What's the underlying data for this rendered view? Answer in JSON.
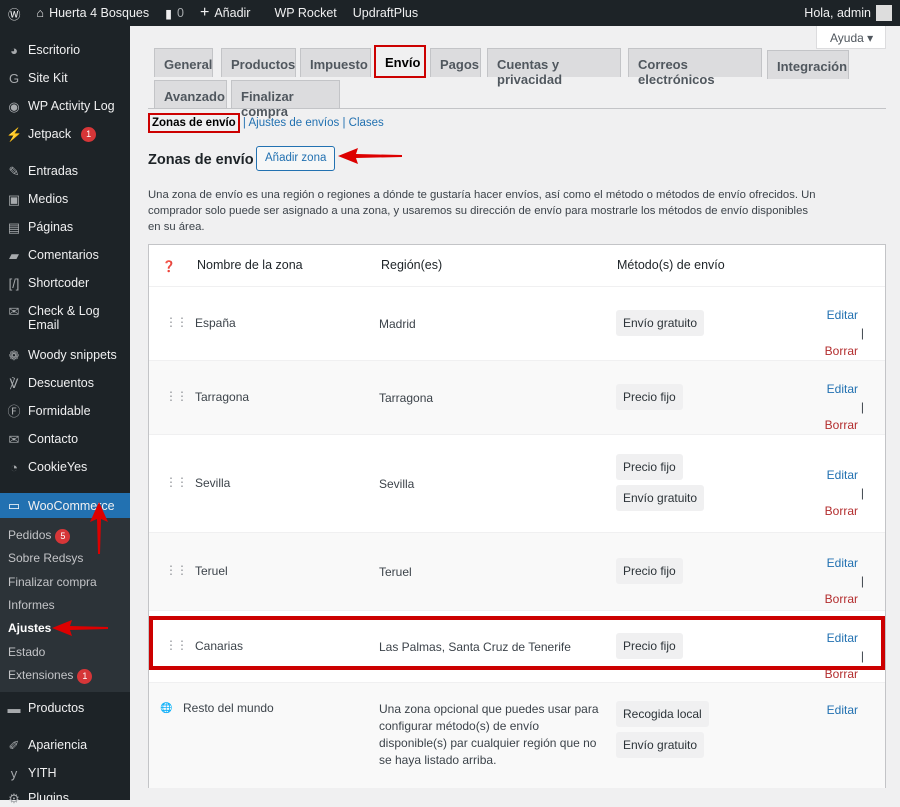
{
  "adminbar": {
    "site": "Huerta 4 Bosques",
    "comments": "0",
    "add": "Añadir",
    "items": [
      "WP Rocket",
      "UpdraftPlus"
    ],
    "greeting": "Hola, admin"
  },
  "sidebar": {
    "items": [
      {
        "label": "Escritorio",
        "icon": "dashboard-icon"
      },
      {
        "label": "Site Kit",
        "icon": "google-icon"
      },
      {
        "label": "WP Activity Log",
        "icon": "eye-icon"
      },
      {
        "label": "Jetpack",
        "icon": "jetpack-icon",
        "badge": "1"
      },
      {
        "label": "Entradas",
        "icon": "pin-icon"
      },
      {
        "label": "Medios",
        "icon": "media-icon"
      },
      {
        "label": "Páginas",
        "icon": "page-icon"
      },
      {
        "label": "Comentarios",
        "icon": "comment-icon"
      },
      {
        "label": "Shortcoder",
        "icon": "shortcode-icon"
      },
      {
        "label": "Check & Log Email",
        "icon": "email-icon"
      },
      {
        "label": "Woody snippets",
        "icon": "snippet-icon"
      },
      {
        "label": "Descuentos",
        "icon": "discount-icon"
      },
      {
        "label": "Formidable",
        "icon": "form-icon"
      },
      {
        "label": "Contacto",
        "icon": "mail-icon"
      },
      {
        "label": "CookieYes",
        "icon": "cookie-icon"
      },
      {
        "label": "WooCommerce",
        "icon": "woo-icon"
      },
      {
        "label": "Productos",
        "icon": "archive-icon"
      },
      {
        "label": "Apariencia",
        "icon": "brush-icon"
      },
      {
        "label": "YITH",
        "icon": "yith-icon"
      },
      {
        "label": "Plugins",
        "icon": "plugin-icon"
      }
    ],
    "submenu": [
      {
        "label": "Pedidos",
        "badge": "5"
      },
      {
        "label": "Sobre Redsys"
      },
      {
        "label": "Finalizar compra"
      },
      {
        "label": "Informes"
      },
      {
        "label": "Ajustes",
        "current": true
      },
      {
        "label": "Estado"
      },
      {
        "label": "Extensiones",
        "badge": "1"
      }
    ]
  },
  "help": "Ayuda",
  "tabs": [
    "General",
    "Productos",
    "Impuesto",
    "Envío",
    "Pagos",
    "Cuentas y privacidad",
    "Correos electrónicos",
    "Integración",
    "Avanzado",
    "Finalizar compra"
  ],
  "active_tab": "Envío",
  "subnav": {
    "current": "Zonas de envío",
    "links": [
      "Ajustes de envíos",
      "Clases"
    ]
  },
  "title": "Zonas de envío",
  "add_zone": "Añadir zona",
  "description": "Una zona de envío es una región o regiones a dónde te gustaría hacer envíos, así como el método o métodos de envío ofrecidos. Un comprador solo puede ser asignado a una zona, y usaremos su dirección de envío para mostrarle los métodos de envío disponibles en su área.",
  "table": {
    "headers": [
      "Nombre de la zona",
      "Región(es)",
      "Método(s) de envío"
    ],
    "rows": [
      {
        "name": "España",
        "region": "Madrid",
        "methods": [
          "Envío gratuito"
        ]
      },
      {
        "name": "Tarragona",
        "region": "Tarragona",
        "methods": [
          "Precio fijo"
        ]
      },
      {
        "name": "Sevilla",
        "region": "Sevilla",
        "methods": [
          "Precio fijo",
          "Envío gratuito"
        ]
      },
      {
        "name": "Teruel",
        "region": "Teruel",
        "methods": [
          "Precio fijo"
        ]
      },
      {
        "name": "Canarias",
        "region": "Las Palmas, Santa Cruz de Tenerife",
        "methods": [
          "Precio fijo"
        ]
      },
      {
        "name": "Resto del mundo",
        "region": "Una zona opcional que puedes usar para configurar método(s) de envío disponible(s) par cualquier región que no se haya listado arriba.",
        "methods": [
          "Recogida local",
          "Envío gratuito"
        ]
      }
    ],
    "edit": "Editar",
    "delete": "Borrar"
  },
  "colors": {
    "accent": "#2271b1",
    "highlight": "#cc0000",
    "delete": "#b32d2e"
  }
}
